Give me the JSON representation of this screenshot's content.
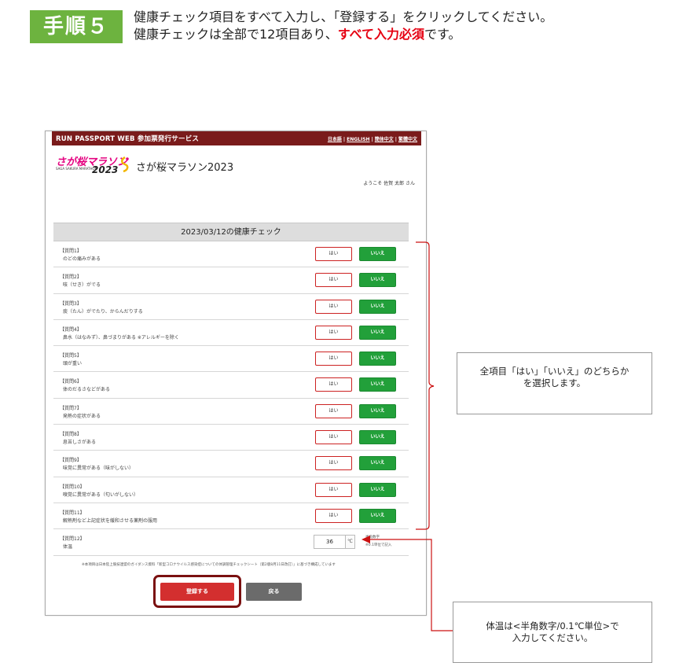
{
  "step": {
    "badge": "手順５",
    "line1": "健康チェック項目をすべて入力し、「登録する」をクリックしてください。",
    "line2_pre": "健康チェックは全部で12項目あり、",
    "line2_req": "すべて入力必須",
    "line2_post": "です。"
  },
  "site": {
    "brand": "RUN PASSPORT WEB  参加票発行サービス",
    "languages": [
      "日本語",
      "ENGLISH",
      "簡体中文",
      "繁體中文"
    ],
    "logo_main": "さが桜マラソン",
    "logo_sub": "SAGA SAKURA MARATHON",
    "logo_year": "2023",
    "event_title": "さが桜マラソン2023",
    "welcome": "ようこそ 佐賀 太郎 さん"
  },
  "form": {
    "title": "2023/03/12の健康チェック",
    "yes_label": "はい",
    "no_label": "いいえ",
    "questions": [
      {
        "num": "【質問1】",
        "text": "のどの痛みがある"
      },
      {
        "num": "【質問2】",
        "text": "咳（せき）がでる"
      },
      {
        "num": "【質問3】",
        "text": "痰（たん）がでたり、からんだりする"
      },
      {
        "num": "【質問4】",
        "text": "鼻水（はなみず）、鼻づまりがある ※アレルギーを除く"
      },
      {
        "num": "【質問5】",
        "text": "頭が重い"
      },
      {
        "num": "【質問6】",
        "text": "体のだるさなどがある"
      },
      {
        "num": "【質問7】",
        "text": "発熱の症状がある"
      },
      {
        "num": "【質問8】",
        "text": "息苦しさがある"
      },
      {
        "num": "【質問9】",
        "text": "味覚に異常がある（味がしない）"
      },
      {
        "num": "【質問10】",
        "text": "嗅覚に異常がある（匂いがしない）"
      },
      {
        "num": "【質問11】",
        "text": "解熱剤など上記症状を緩和させる薬剤の服用"
      }
    ],
    "temperature": {
      "num": "【質問12】",
      "text": "体温",
      "value": "36",
      "unit": "℃",
      "note1": "半角数字",
      "note2": "※0.1単位で記入"
    },
    "footnote": "※本項目は日本陸上競技連盟のガイダンス資料「新型コロナウイルス感染症についての体調管理チェックシート（第2版8月11日改訂）」に基づき構成しています",
    "submit_label": "登録する",
    "back_label": "戻る"
  },
  "callouts": {
    "c1_line1": "全項目「はい」「いいえ」のどちらか",
    "c1_line2": "を選択します。",
    "c2_line1": "体温は<半角数字/0.1℃単位>で",
    "c2_line2": "入力してください。"
  },
  "colors": {
    "step_badge": "#6db33f",
    "required_text": "#e60012",
    "topbar": "#7a1b1b",
    "yes_border": "#cc2222",
    "no_button": "#22a03a",
    "submit_button": "#d32f2f",
    "back_button": "#6b6b6b",
    "arrow": "#cc1111"
  }
}
